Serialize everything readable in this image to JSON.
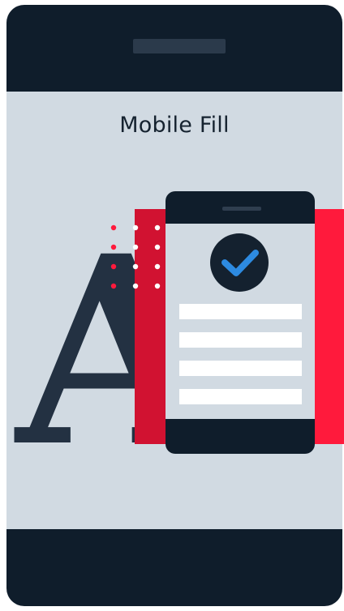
{
  "screen": {
    "title": "Mobile Fill"
  },
  "illustration": {
    "serif_letter": "A",
    "icons": [
      "checkmark-icon"
    ],
    "colors": {
      "device": "#0f1d2b",
      "screen": "#d1dae2",
      "accent_red": "#ff1a3c",
      "check_blue": "#2d8ae0",
      "letter": "#233142"
    }
  }
}
